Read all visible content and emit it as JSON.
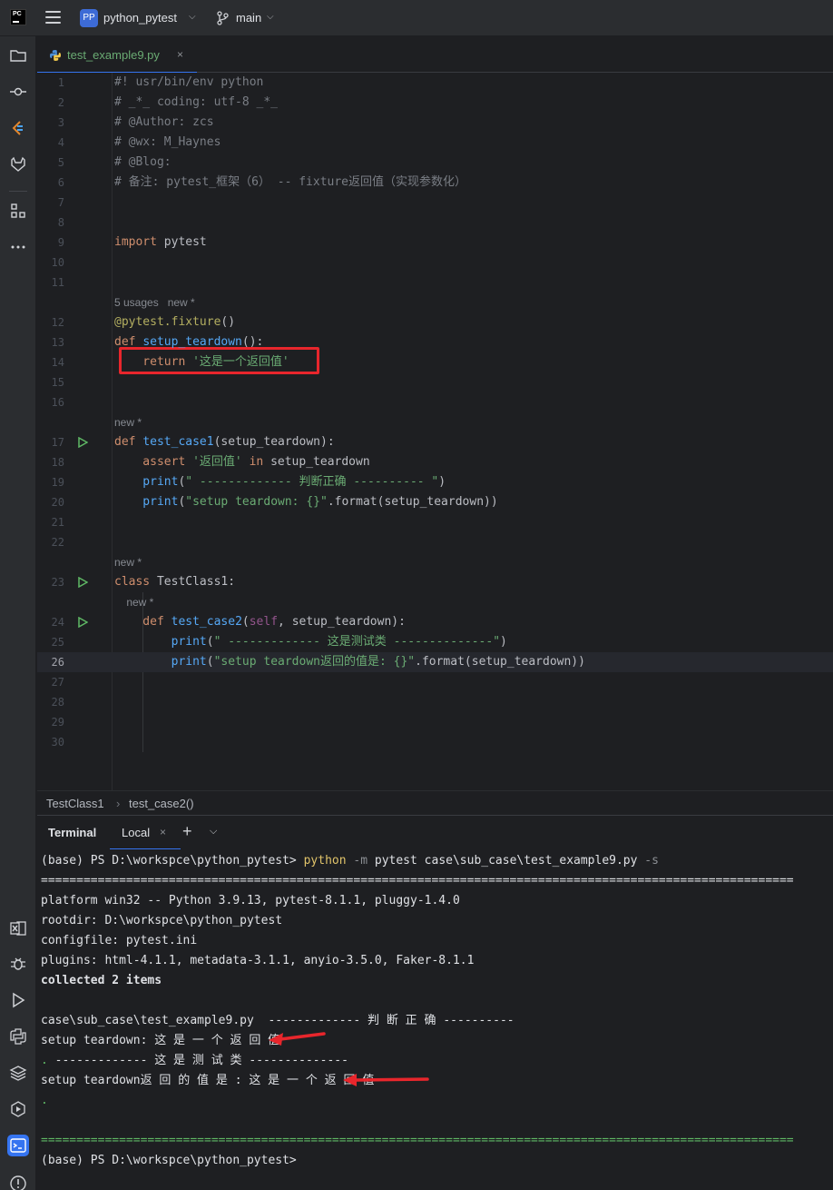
{
  "titlebar": {
    "logo_text": "PC",
    "project_badge": "PP",
    "project_name": "python_pytest",
    "branch_name": "main"
  },
  "editor_tab": {
    "filename": "test_example9.py",
    "close": "×"
  },
  "editor": {
    "lines": [
      {
        "n": "1",
        "segments": [
          {
            "t": "#! usr/bin/env python",
            "c": "cmt"
          }
        ]
      },
      {
        "n": "2",
        "segments": [
          {
            "t": "# _*_ coding: utf-8 _*_",
            "c": "cmt"
          }
        ]
      },
      {
        "n": "3",
        "segments": [
          {
            "t": "# @Author: zcs",
            "c": "cmt"
          }
        ]
      },
      {
        "n": "4",
        "segments": [
          {
            "t": "# @wx: M_Haynes",
            "c": "cmt"
          }
        ]
      },
      {
        "n": "5",
        "segments": [
          {
            "t": "# @Blog:",
            "c": "cmt"
          }
        ]
      },
      {
        "n": "6",
        "segments": [
          {
            "t": "# 备注: pytest_框架（6） -- fixture返回值（实现参数化）",
            "c": "cmt"
          }
        ]
      },
      {
        "n": "7",
        "segments": []
      },
      {
        "n": "8",
        "segments": []
      },
      {
        "n": "9",
        "segments": [
          {
            "t": "import",
            "c": "kw"
          },
          {
            "t": " pytest",
            "c": ""
          }
        ]
      },
      {
        "n": "10",
        "segments": []
      },
      {
        "n": "11",
        "segments": []
      },
      {
        "hint": "5 usages   new *"
      },
      {
        "n": "12",
        "segments": [
          {
            "t": "@pytest.fixture",
            "c": "deco"
          },
          {
            "t": "()",
            "c": ""
          }
        ]
      },
      {
        "n": "13",
        "segments": [
          {
            "t": "def",
            "c": "kw"
          },
          {
            "t": " ",
            "c": ""
          },
          {
            "t": "setup_teardown",
            "c": "fn"
          },
          {
            "t": "():",
            "c": ""
          }
        ]
      },
      {
        "n": "14",
        "segments": [
          {
            "t": "    return",
            "c": "kw"
          },
          {
            "t": " ",
            "c": ""
          },
          {
            "t": "'这是一个返回值'",
            "c": "str"
          }
        ]
      },
      {
        "n": "15",
        "segments": []
      },
      {
        "n": "16",
        "segments": []
      },
      {
        "hint": "new *"
      },
      {
        "n": "17",
        "run": true,
        "segments": [
          {
            "t": "def",
            "c": "kw"
          },
          {
            "t": " ",
            "c": ""
          },
          {
            "t": "test_case1",
            "c": "fn"
          },
          {
            "t": "(setup_teardown):",
            "c": ""
          }
        ]
      },
      {
        "n": "18",
        "segments": [
          {
            "t": "    assert",
            "c": "kw"
          },
          {
            "t": " ",
            "c": ""
          },
          {
            "t": "'返回值'",
            "c": "str"
          },
          {
            "t": " ",
            "c": ""
          },
          {
            "t": "in",
            "c": "kw"
          },
          {
            "t": " setup_teardown",
            "c": ""
          }
        ]
      },
      {
        "n": "19",
        "segments": [
          {
            "t": "    print",
            "c": "fn"
          },
          {
            "t": "(",
            "c": ""
          },
          {
            "t": "\" ------------- 判断正确 ---------- \"",
            "c": "str"
          },
          {
            "t": ")",
            "c": ""
          }
        ]
      },
      {
        "n": "20",
        "segments": [
          {
            "t": "    print",
            "c": "fn"
          },
          {
            "t": "(",
            "c": ""
          },
          {
            "t": "\"setup teardown: {}\"",
            "c": "str"
          },
          {
            "t": ".format(setup_teardown))",
            "c": ""
          }
        ]
      },
      {
        "n": "21",
        "segments": []
      },
      {
        "n": "22",
        "segments": []
      },
      {
        "hint": "new *"
      },
      {
        "n": "23",
        "run": true,
        "segments": [
          {
            "t": "class",
            "c": "kw"
          },
          {
            "t": " TestClass1:",
            "c": ""
          }
        ]
      },
      {
        "hint": "    new *"
      },
      {
        "n": "24",
        "run": true,
        "segments": [
          {
            "t": "    def",
            "c": "kw"
          },
          {
            "t": " ",
            "c": ""
          },
          {
            "t": "test_case2",
            "c": "fn"
          },
          {
            "t": "(",
            "c": ""
          },
          {
            "t": "self",
            "c": "self"
          },
          {
            "t": ", setup_teardown):",
            "c": ""
          }
        ]
      },
      {
        "n": "25",
        "segments": [
          {
            "t": "        print",
            "c": "fn"
          },
          {
            "t": "(",
            "c": ""
          },
          {
            "t": "\" ------------- 这是测试类 --------------\"",
            "c": "str"
          },
          {
            "t": ")",
            "c": ""
          }
        ]
      },
      {
        "n": "26",
        "current": true,
        "segments": [
          {
            "t": "        print",
            "c": "fn"
          },
          {
            "t": "(",
            "c": ""
          },
          {
            "t": "\"setup teardown返回的值是: {}\"",
            "c": "str"
          },
          {
            "t": ".format(setup_teardown))",
            "c": ""
          }
        ]
      },
      {
        "n": "27",
        "segments": []
      },
      {
        "n": "28",
        "segments": []
      },
      {
        "n": "29",
        "segments": []
      },
      {
        "n": "30",
        "segments": []
      }
    ]
  },
  "breadcrumb": {
    "class": "TestClass1",
    "separator": "›",
    "method": "test_case2()"
  },
  "terminal": {
    "title": "Terminal",
    "tab_label": "Local",
    "tab_close": "×",
    "new_tab": "+",
    "lines": [
      {
        "segments": [
          {
            "t": "(base) PS D:\\workspce\\python_pytest> ",
            "c": ""
          },
          {
            "t": "python",
            "c": "t-cmd"
          },
          {
            "t": " -m ",
            "c": "t-flag"
          },
          {
            "t": "pytest case\\sub_case\\test_example9.py ",
            "c": ""
          },
          {
            "t": "-s",
            "c": "t-flag"
          }
        ]
      },
      {
        "segments": [
          {
            "t": "==========================================================================================================",
            "c": ""
          }
        ]
      },
      {
        "segments": [
          {
            "t": "platform win32 -- Python 3.9.13, pytest-8.1.1, pluggy-1.4.0",
            "c": ""
          }
        ]
      },
      {
        "segments": [
          {
            "t": "rootdir: D:\\workspce\\python_pytest",
            "c": ""
          }
        ]
      },
      {
        "segments": [
          {
            "t": "configfile: pytest.ini",
            "c": ""
          }
        ]
      },
      {
        "segments": [
          {
            "t": "plugins: html-4.1.1, metadata-3.1.1, anyio-3.5.0, Faker-8.1.1",
            "c": ""
          }
        ]
      },
      {
        "segments": [
          {
            "t": "collected 2 items",
            "c": "t-bold"
          }
        ]
      },
      {
        "segments": []
      },
      {
        "segments": [
          {
            "t": "case\\sub_case\\test_example9.py  ------------- 判 断 正 确 ----------",
            "c": ""
          }
        ]
      },
      {
        "segments": [
          {
            "t": "setup teardown: 这 是 一 个 返 回 值",
            "c": ""
          }
        ]
      },
      {
        "segments": [
          {
            "t": ".",
            "c": "t-green"
          },
          {
            "t": " ------------- 这 是 测 试 类 --------------",
            "c": ""
          }
        ]
      },
      {
        "segments": [
          {
            "t": "setup teardown返 回 的 值 是 : 这 是 一 个 返 回 值",
            "c": ""
          }
        ]
      },
      {
        "segments": [
          {
            "t": ".",
            "c": "t-green"
          }
        ]
      },
      {
        "segments": []
      },
      {
        "segments": [
          {
            "t": "==========================================================================================================",
            "c": "t-green"
          }
        ]
      },
      {
        "segments": [
          {
            "t": "(base) PS D:\\workspce\\python_pytest>",
            "c": ""
          }
        ]
      }
    ]
  },
  "icons": {
    "left_strip": [
      "folder-icon",
      "commit-icon",
      "pull-requests-icon",
      "gitlab-icon",
      "structure-icon",
      "more-icon",
      "excel-icon",
      "debug-icon",
      "run-icon",
      "python-console-icon",
      "layers-icon",
      "services-icon",
      "terminal-icon",
      "problems-icon"
    ]
  },
  "colors": {
    "accent": "#3574f0",
    "annotation_red": "#e8262c",
    "keyword": "#cf8e6d",
    "function": "#56a8f5",
    "string": "#6aab73",
    "comment": "#7a7e85"
  }
}
